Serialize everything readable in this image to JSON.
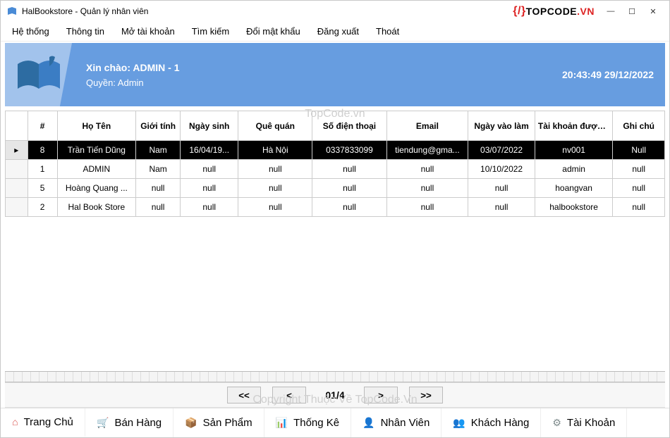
{
  "window": {
    "title": "HalBookstore - Quản lý nhân viên"
  },
  "logo": {
    "text_top": "TOPCODE",
    "text_vn": ".VN"
  },
  "win_controls": {
    "min": "—",
    "max": "☐",
    "close": "✕"
  },
  "menu": [
    "Hệ thống",
    "Thông tin",
    "Mở tài khoản",
    "Tìm kiếm",
    "Đổi mật khẩu",
    "Đăng xuất",
    "Thoát"
  ],
  "banner": {
    "greet": "Xin chào: ADMIN - 1",
    "role": "Quyền: Admin",
    "time": "20:43:49 29/12/2022"
  },
  "watermark_center": "TopCode.vn",
  "watermark_bottom": "Copyright Thuộc Về TopCode.Vn",
  "table": {
    "headers": [
      "",
      "#",
      "Họ Tên",
      "Giới tính",
      "Ngày sinh",
      "Quê quán",
      "Số điện thoại",
      "Email",
      "Ngày vào làm",
      "Tài khoản được cấp",
      "Ghi chú"
    ],
    "rows": [
      {
        "selected": true,
        "marker": "▸",
        "cells": [
          "8",
          "Trần Tiến Dũng",
          "Nam",
          "16/04/19...",
          "Hà Nội",
          "0337833099",
          "tiendung@gma...",
          "03/07/2022",
          "nv001",
          "Null"
        ]
      },
      {
        "selected": false,
        "marker": "",
        "cells": [
          "1",
          "ADMIN",
          "Nam",
          "null",
          "null",
          "null",
          "null",
          "10/10/2022",
          "admin",
          "null"
        ]
      },
      {
        "selected": false,
        "marker": "",
        "cells": [
          "5",
          "Hoàng Quang ...",
          "null",
          "null",
          "null",
          "null",
          "null",
          "null",
          "hoangvan",
          "null"
        ]
      },
      {
        "selected": false,
        "marker": "",
        "cells": [
          "2",
          "Hal Book Store",
          "null",
          "null",
          "null",
          "null",
          "null",
          "null",
          "halbookstore",
          "null"
        ]
      }
    ]
  },
  "pager": {
    "first": "<<",
    "prev": "<",
    "label": "01/4",
    "next": ">",
    "last": ">>"
  },
  "tabs": [
    {
      "icon": "⌂",
      "label": "Trang Chủ",
      "color": "#d9534f"
    },
    {
      "icon": "🛒",
      "label": "Bán Hàng",
      "color": "#5b9e5b"
    },
    {
      "icon": "📦",
      "label": "Sản Phẩm",
      "color": "#8a6d3b"
    },
    {
      "icon": "📊",
      "label": "Thống Kê",
      "color": "#9b59b6"
    },
    {
      "icon": "👤",
      "label": "Nhân Viên",
      "color": "#2d6ca2"
    },
    {
      "icon": "👥",
      "label": "Khách Hàng",
      "color": "#c0392b"
    },
    {
      "icon": "⚙",
      "label": "Tài Khoản",
      "color": "#7f8c8d"
    }
  ]
}
